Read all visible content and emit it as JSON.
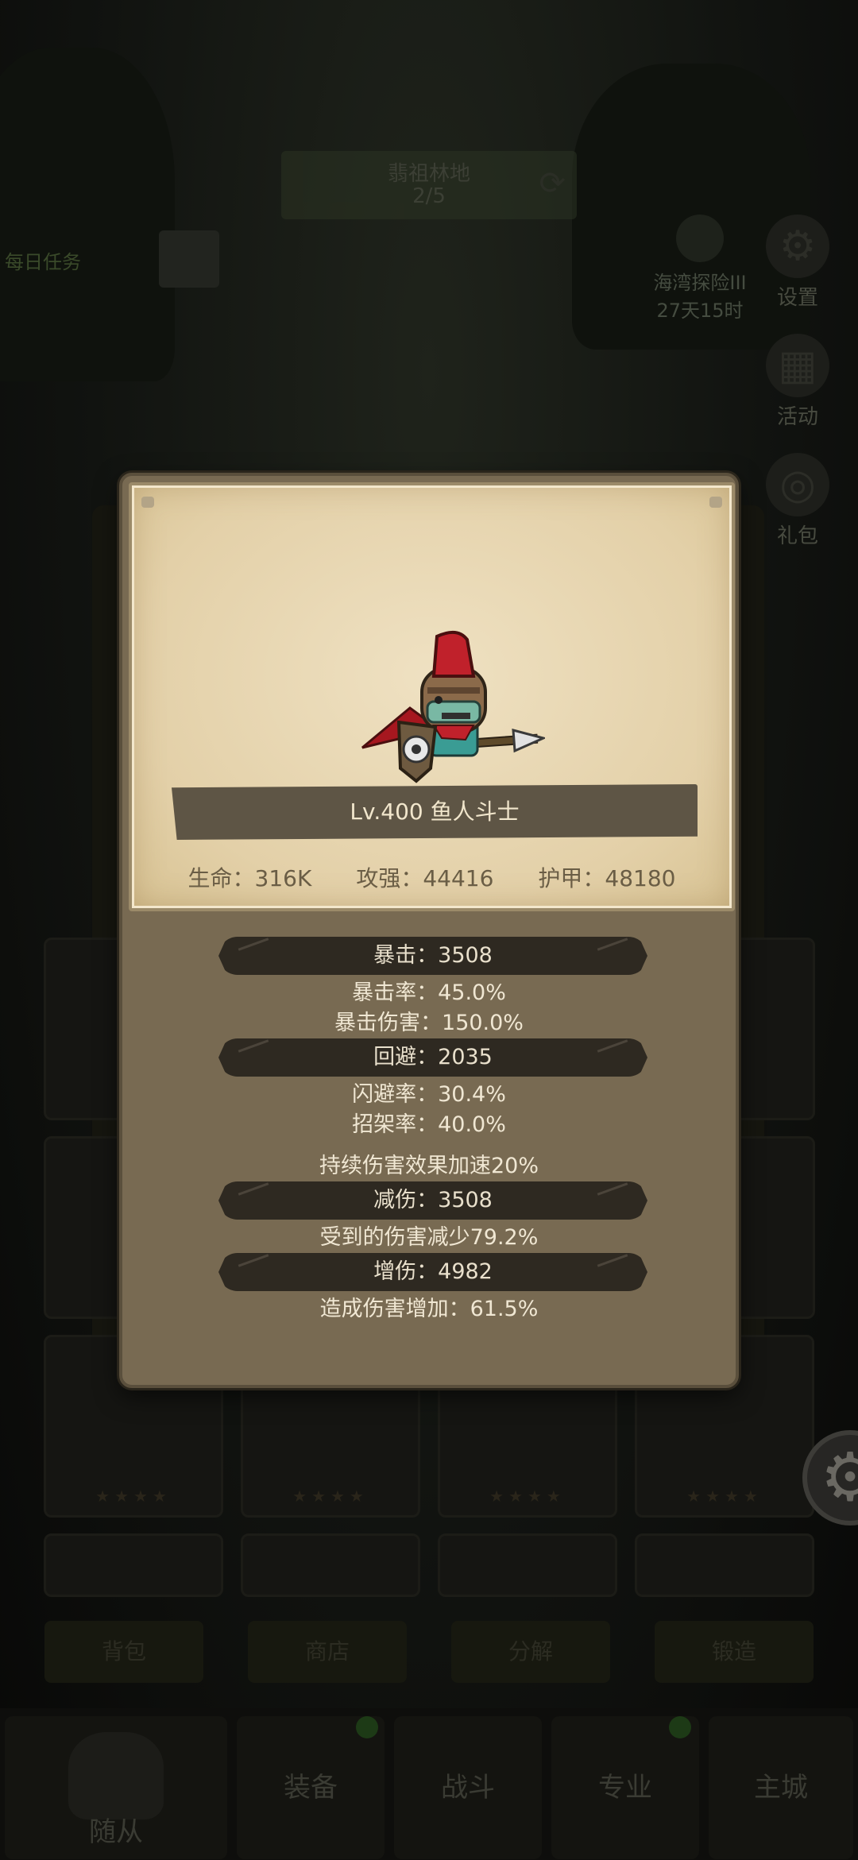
{
  "background": {
    "stage_name": "翡祖林地",
    "stage_progress": "2/5",
    "quest_text": "每日任务",
    "event": {
      "name": "海湾探险III",
      "timer": "27天15时"
    },
    "side_buttons": [
      {
        "label": "设置",
        "icon": "gear-icon"
      },
      {
        "label": "活动",
        "icon": "calendar-icon"
      },
      {
        "label": "礼包",
        "icon": "gift-icon"
      }
    ],
    "tabs": [
      "背包",
      "商店",
      "分解",
      "锻造"
    ],
    "nav": [
      {
        "label": "随从",
        "icon": "helmet-icon"
      },
      {
        "label": "装备"
      },
      {
        "label": "战斗"
      },
      {
        "label": "专业"
      },
      {
        "label": "主城"
      }
    ],
    "stars": "★★★★"
  },
  "hero": {
    "name": "Lv.400 鱼人斗士",
    "stats": [
      {
        "label": "生命：316K"
      },
      {
        "label": "攻强：44416"
      },
      {
        "label": "护甲：48180"
      }
    ]
  },
  "attributes": {
    "crit": "暴击：3508",
    "crit_rate": "暴击率：45.0%",
    "crit_damage": "暴击伤害：150.0%",
    "evade": "回避：2035",
    "dodge_rate": "闪避率：30.4%",
    "parry_rate": "招架率：40.0%",
    "dot_bonus": "持续伤害效果加速20%",
    "reduction": "减伤：3508",
    "damage_taken": "受到的伤害减少79.2%",
    "amplify": "增伤：4982",
    "damage_dealt": "造成伤害增加：61.5%"
  },
  "colors": {
    "popup_body": "#786a52",
    "parchment": "#e8d6b0",
    "bar_dark": "#2e2921",
    "hero_hat": "#c0212b",
    "hero_cape": "#a6171f"
  }
}
